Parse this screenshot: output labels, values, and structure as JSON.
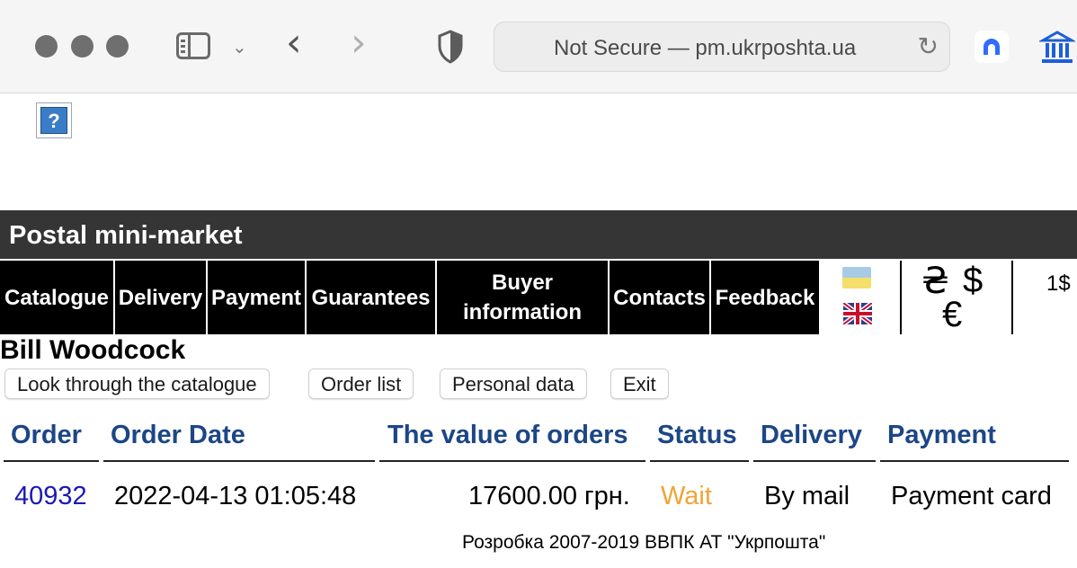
{
  "browser": {
    "url_display": "Not Secure — pm.ukrposhta.ua",
    "icons": [
      "sidebar-icon",
      "chevron-down-icon",
      "back-arrow-icon",
      "forward-arrow-icon",
      "shield-icon",
      "reload-icon",
      "extension-icon",
      "bank-icon"
    ]
  },
  "broken_image_glyph": "?",
  "site": {
    "title": "Postal mini-market"
  },
  "menu": {
    "items": [
      {
        "label": "Catalogue"
      },
      {
        "label": "Delivery"
      },
      {
        "label": "Payment"
      },
      {
        "label": "Guarantees"
      },
      {
        "label": "Buyer information"
      },
      {
        "label": "Contacts"
      },
      {
        "label": "Feedback"
      }
    ],
    "currency": {
      "uah": "₴",
      "usd": "$",
      "eur": "€",
      "rate": "1$"
    }
  },
  "user": {
    "name": "Bill Woodcock"
  },
  "actions": {
    "catalogue": "Look through the catalogue",
    "orders": "Order list",
    "personal": "Personal data",
    "exit": "Exit"
  },
  "table": {
    "headers": {
      "order": "Order",
      "date": "Order Date",
      "value": "The value of orders",
      "status": "Status",
      "delivery": "Delivery",
      "payment": "Payment"
    },
    "rows": [
      {
        "order": "40932",
        "date": "2022-04-13 01:05:48",
        "value": "17600.00 грн.",
        "status": "Wait",
        "delivery": "By mail",
        "payment": "Payment card"
      }
    ]
  },
  "footer": {
    "text": "Розробка 2007-2019 ВВПК АТ \"Укрпошта\""
  },
  "colors": {
    "title_bar": "#353535",
    "menu_bg": "#000000",
    "header_text": "#1c4686",
    "link": "#1a1ab4",
    "status_wait": "#f0a435"
  }
}
